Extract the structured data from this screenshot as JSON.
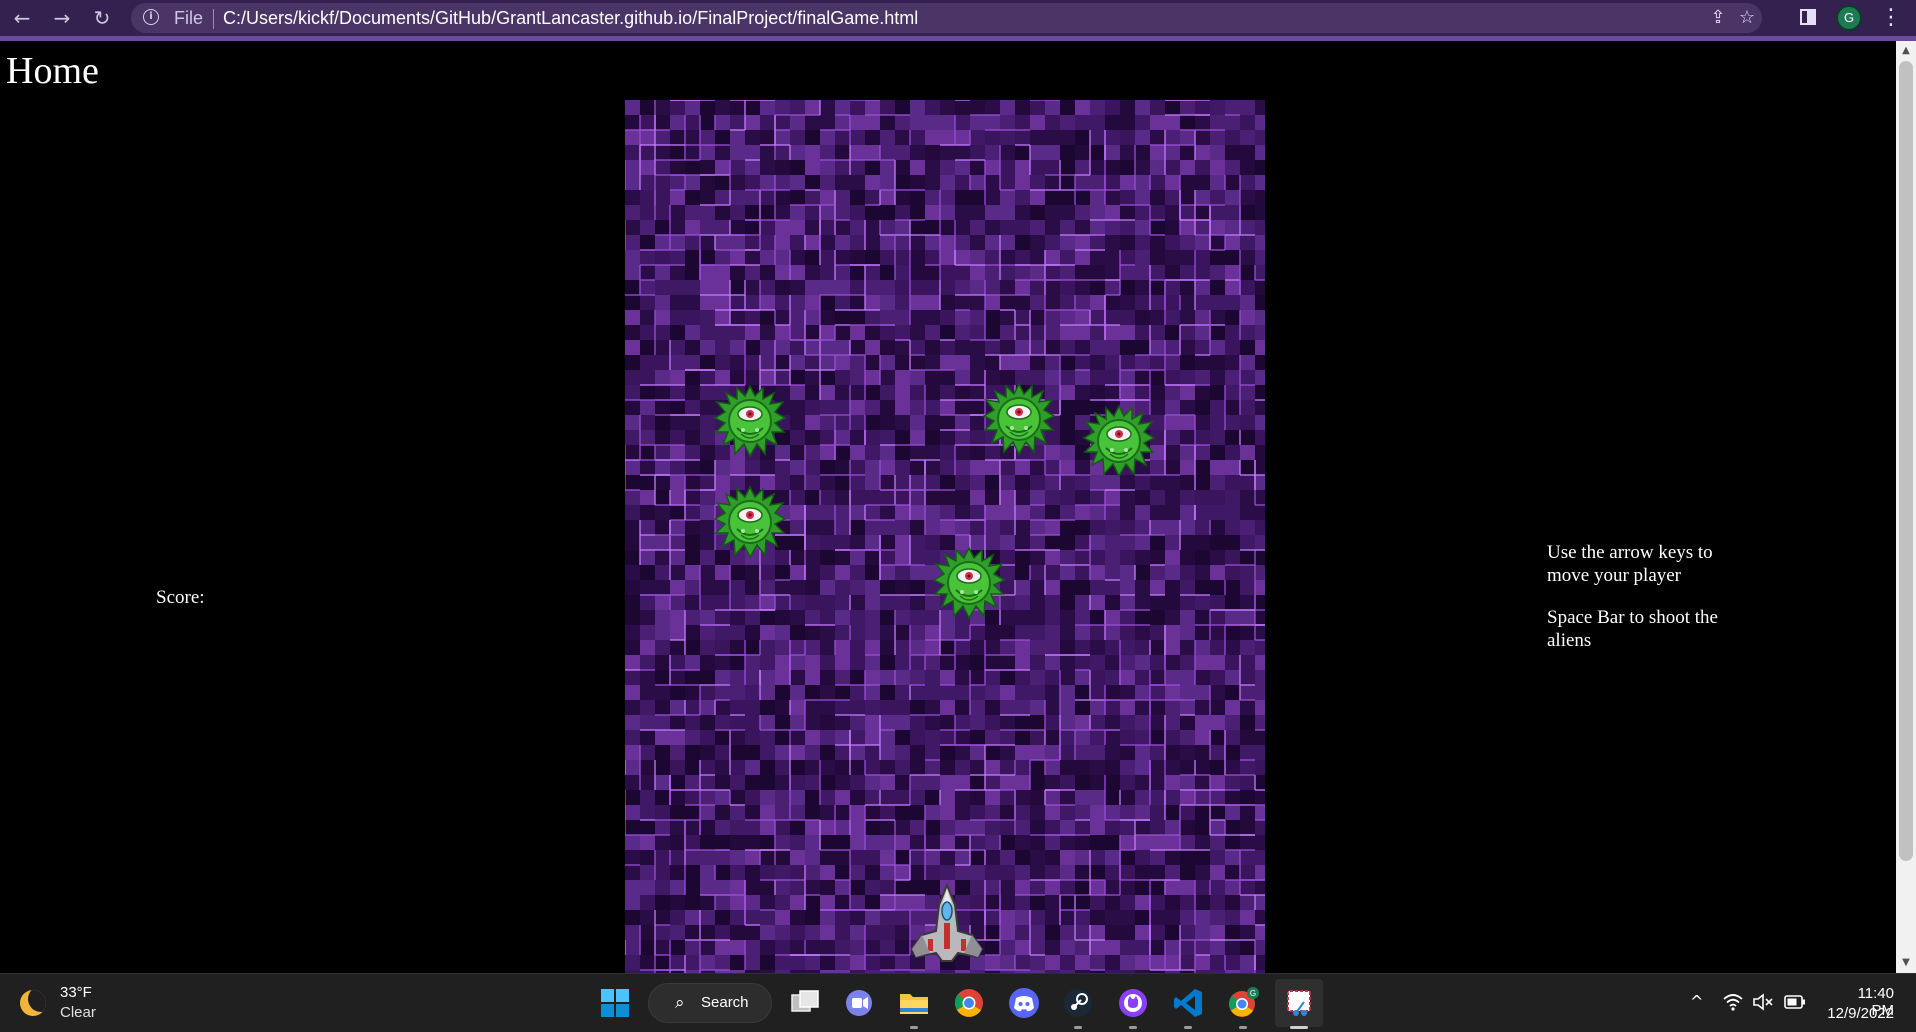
{
  "browser": {
    "back_icon": "arrow-left-icon",
    "forward_icon": "arrow-right-icon",
    "reload_icon": "reload-icon",
    "site_info_label": "File",
    "url": "C:/Users/kickf/Documents/GitHub/GrantLancaster.github.io/FinalProject/finalGame.html",
    "profile_initial": "G",
    "accent_color": "#35214f"
  },
  "page": {
    "home_link": "Home",
    "score_label": "Score:",
    "instructions": {
      "move": "Use the arrow keys to move your player",
      "shoot": "Space Bar to shoot the aliens"
    }
  },
  "game": {
    "background": "purple-tile-grid",
    "aliens": [
      "green-one-eyed-alien",
      "green-one-eyed-alien",
      "green-one-eyed-alien",
      "green-one-eyed-alien",
      "green-one-eyed-alien"
    ],
    "player": "spaceship"
  },
  "taskbar": {
    "weather": {
      "temp": "33°F",
      "condition": "Clear"
    },
    "search_label": "Search",
    "apps": [
      "windows-start",
      "search",
      "task-view",
      "teams-chat",
      "file-explorer",
      "chrome",
      "discord",
      "steam",
      "github-desktop",
      "vs-code",
      "chrome-profile",
      "snipping-tool"
    ],
    "clock": {
      "time": "11:40 PM",
      "date": "12/9/2022"
    }
  }
}
